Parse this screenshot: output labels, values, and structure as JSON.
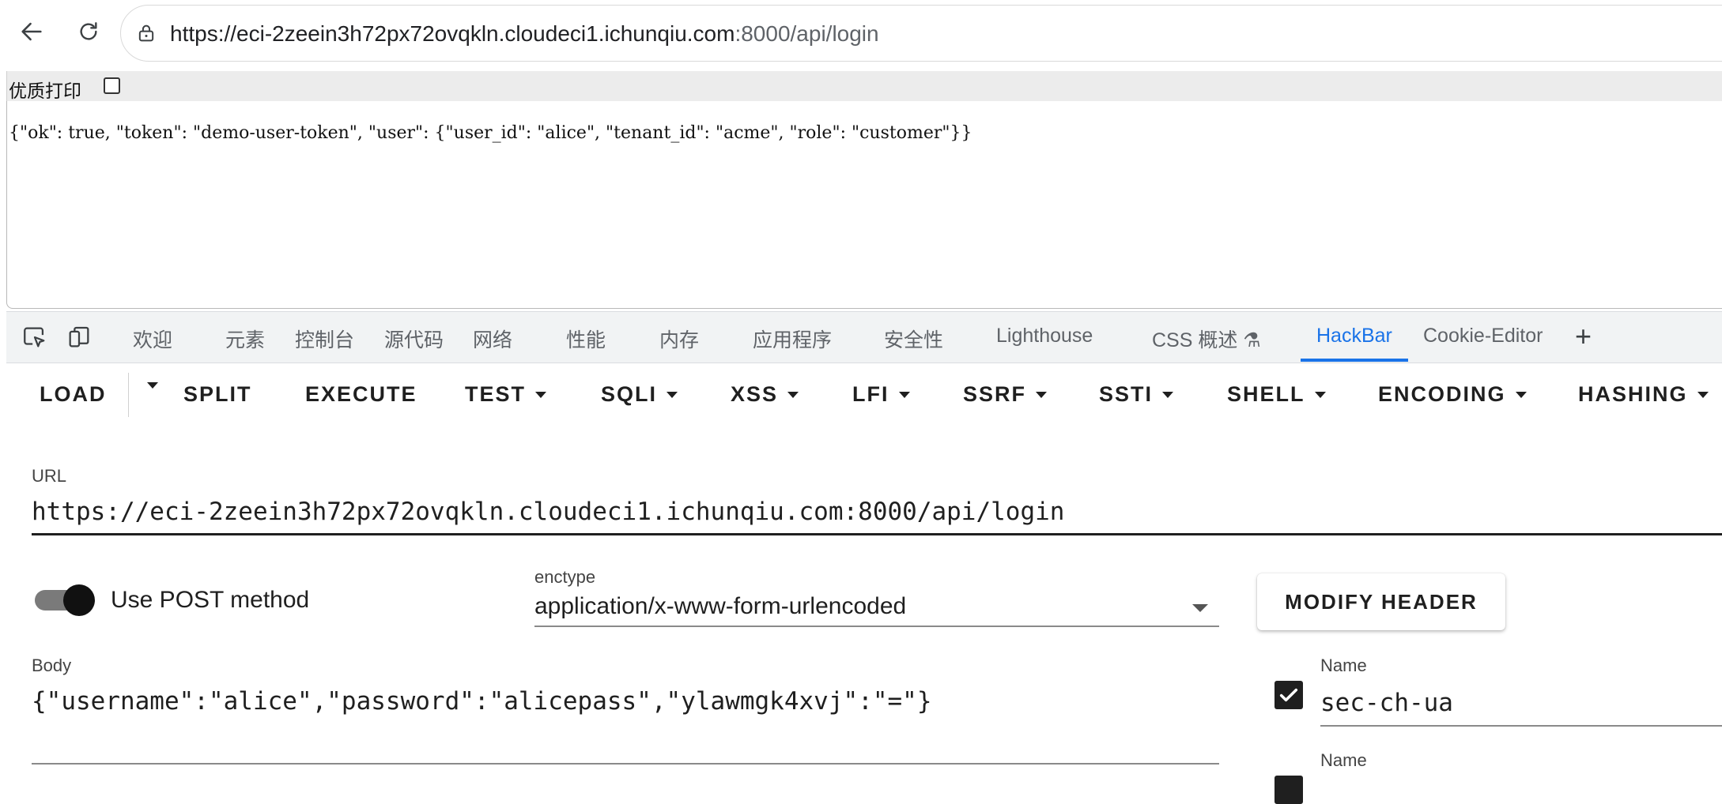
{
  "browser": {
    "url_host": "https://eci-2zeein3h72px72ovqkln.cloudeci1.ichunqiu.com",
    "url_path": ":8000/api/login"
  },
  "page": {
    "print_label": "优质打印",
    "json_response": "{\"ok\": true, \"token\": \"demo-user-token\", \"user\": {\"user_id\": \"alice\", \"tenant_id\": \"acme\", \"role\": \"customer\"}}"
  },
  "devtools": {
    "tabs": [
      "欢迎",
      "元素",
      "控制台",
      "源代码",
      "网络",
      "性能",
      "内存",
      "应用程序",
      "安全性",
      "Lighthouse",
      "CSS 概述 ⚗",
      "HackBar",
      "Cookie-Editor"
    ],
    "active_tab": "HackBar"
  },
  "hackbar": {
    "toolbar": {
      "load": "LOAD",
      "split": "SPLIT",
      "execute": "EXECUTE",
      "test": "TEST",
      "sqli": "SQLI",
      "xss": "XSS",
      "lfi": "LFI",
      "ssrf": "SSRF",
      "ssti": "SSTI",
      "shell": "SHELL",
      "encoding": "ENCODING",
      "hashing": "HASHING"
    },
    "url_label": "URL",
    "url_value": "https://eci-2zeein3h72px72ovqkln.cloudeci1.ichunqiu.com:8000/api/login",
    "post_toggle_label": "Use POST method",
    "post_enabled": true,
    "enctype_label": "enctype",
    "enctype_value": "application/x-www-form-urlencoded",
    "modify_header_label": "MODIFY HEADER",
    "body_label": "Body",
    "body_value": "{\"username\":\"alice\",\"password\":\"alicepass\",\"ylawmgk4xvj\":\"=\"}",
    "headers": [
      {
        "name_label": "Name",
        "name_value": "sec-ch-ua",
        "checked": true
      },
      {
        "name_label": "Name",
        "name_value": "",
        "checked": true
      }
    ]
  }
}
